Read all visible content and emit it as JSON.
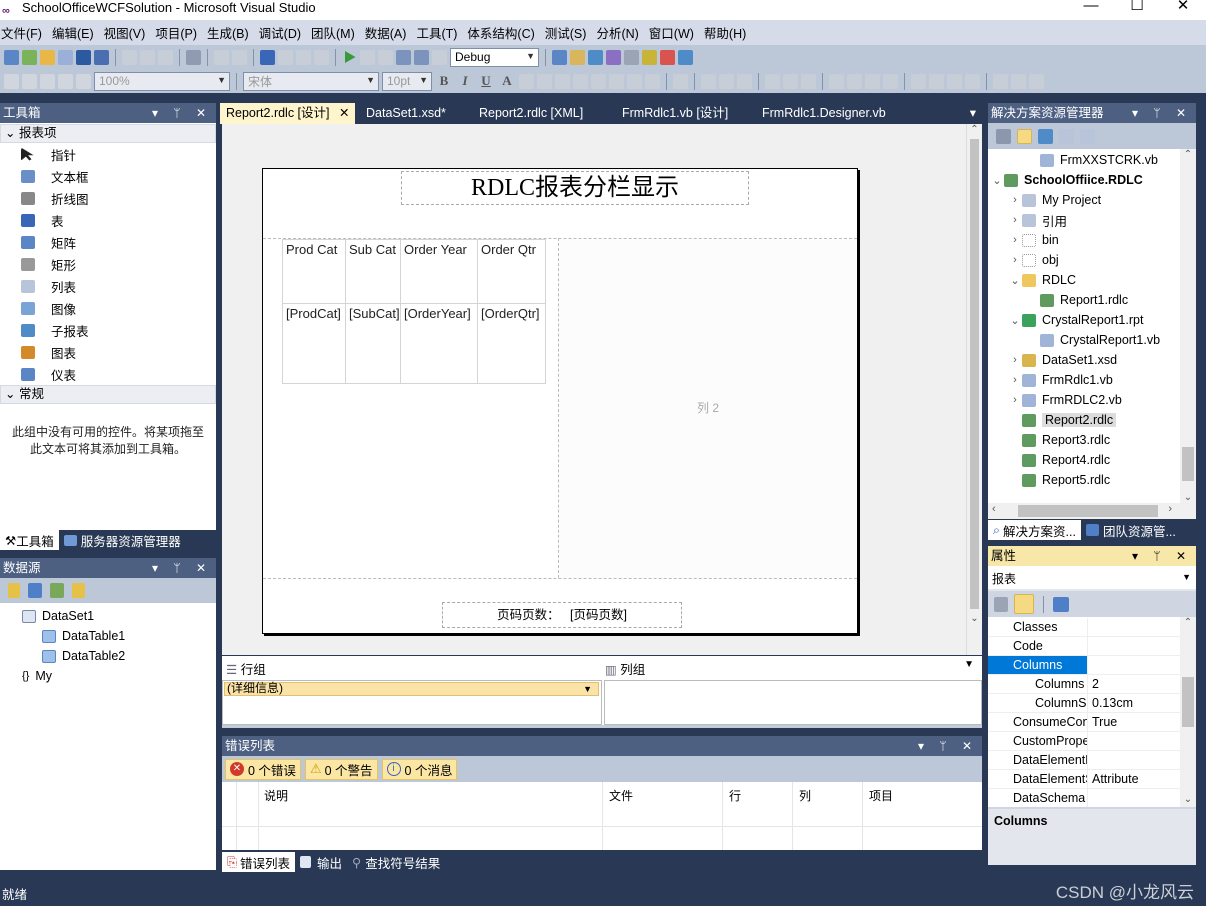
{
  "window": {
    "title": "SchoolOfficeWCFSolution - Microsoft Visual Studio",
    "minimize": "—",
    "maximize": "☐",
    "close": "✕"
  },
  "menu": [
    "文件(F)",
    "编辑(E)",
    "视图(V)",
    "项目(P)",
    "生成(B)",
    "调试(D)",
    "团队(M)",
    "数据(A)",
    "工具(T)",
    "体系结构(C)",
    "测试(S)",
    "分析(N)",
    "窗口(W)",
    "帮助(H)"
  ],
  "toolbar": {
    "config": "Debug",
    "zoom": "100%",
    "font": "宋体",
    "font_size": "10pt",
    "bold": "B",
    "italic": "I",
    "underline": "U",
    "fontcolor": "A"
  },
  "toolbox": {
    "title": "工具箱",
    "category1": "报表项",
    "items": [
      {
        "label": "指针",
        "icon": "pointer-icon"
      },
      {
        "label": "文本框",
        "icon": "textbox-icon"
      },
      {
        "label": "折线图",
        "icon": "line-icon"
      },
      {
        "label": "表",
        "icon": "table-icon"
      },
      {
        "label": "矩阵",
        "icon": "matrix-icon"
      },
      {
        "label": "矩形",
        "icon": "rectangle-icon"
      },
      {
        "label": "列表",
        "icon": "list-icon"
      },
      {
        "label": "图像",
        "icon": "image-icon"
      },
      {
        "label": "子报表",
        "icon": "subreport-icon"
      },
      {
        "label": "图表",
        "icon": "chart-icon"
      },
      {
        "label": "仪表",
        "icon": "gauge-icon"
      }
    ],
    "category2": "常规",
    "empty_text": "此组中没有可用的控件。将某项拖至此文本可将其添加到工具箱。",
    "tabs": [
      "工具箱",
      "服务器资源管理器"
    ]
  },
  "datasource": {
    "title": "数据源",
    "tree": [
      {
        "label": "DataSet1",
        "level": 1
      },
      {
        "label": "DataTable1",
        "level": 2
      },
      {
        "label": "DataTable2",
        "level": 2
      },
      {
        "label": "My",
        "level": 1
      }
    ]
  },
  "doc_tabs": [
    "Report2.rdlc [设计]",
    "DataSet1.xsd*",
    "Report2.rdlc [XML]",
    "FrmRdlc1.vb [设计]",
    "FrmRdlc1.Designer.vb"
  ],
  "report": {
    "title": "RDLC报表分栏显示",
    "headers": [
      "Prod Cat",
      "Sub Cat",
      "Order Year",
      "Order Qtr"
    ],
    "fields": [
      "[ProdCat]",
      "[SubCat]",
      "[OrderYear]",
      "[OrderQtr]"
    ],
    "column2": "列 2",
    "footer": "页码页数：   [页码页数]"
  },
  "grouping": {
    "row_group": "行组",
    "col_group": "列组",
    "detail": "(详细信息)"
  },
  "errorlist": {
    "title": "错误列表",
    "errors": "0 个错误",
    "warnings": "0 个警告",
    "messages": "0 个消息",
    "columns": [
      "说明",
      "文件",
      "行",
      "列",
      "项目"
    ],
    "tabs": [
      "错误列表",
      "输出",
      "查找符号结果"
    ]
  },
  "solution": {
    "title": "解决方案资源管理器",
    "tree": [
      {
        "label": "FrmXXSTCRK.vb",
        "level": 2,
        "chev": ""
      },
      {
        "label": "SchoolOffiice.RDLC",
        "level": 0,
        "chev": "⌄",
        "bold": true
      },
      {
        "label": "My Project",
        "level": 1,
        "chev": "›"
      },
      {
        "label": "引用",
        "level": 1,
        "chev": "›"
      },
      {
        "label": "bin",
        "level": 1,
        "chev": "›"
      },
      {
        "label": "obj",
        "level": 1,
        "chev": "›"
      },
      {
        "label": "RDLC",
        "level": 1,
        "chev": "⌄"
      },
      {
        "label": "Report1.rdlc",
        "level": 2,
        "chev": ""
      },
      {
        "label": "CrystalReport1.rpt",
        "level": 1,
        "chev": "⌄"
      },
      {
        "label": "CrystalReport1.vb",
        "level": 2,
        "chev": ""
      },
      {
        "label": "DataSet1.xsd",
        "level": 1,
        "chev": "›"
      },
      {
        "label": "FrmRdlc1.vb",
        "level": 1,
        "chev": "›"
      },
      {
        "label": "FrmRDLC2.vb",
        "level": 1,
        "chev": "›"
      },
      {
        "label": "Report2.rdlc",
        "level": 1,
        "chev": "",
        "selected": true
      },
      {
        "label": "Report3.rdlc",
        "level": 1,
        "chev": ""
      },
      {
        "label": "Report4.rdlc",
        "level": 1,
        "chev": ""
      },
      {
        "label": "Report5.rdlc",
        "level": 1,
        "chev": ""
      }
    ],
    "tabs": [
      "解决方案资...",
      "团队资源管..."
    ]
  },
  "properties": {
    "title": "属性",
    "object": "报表",
    "rows": [
      {
        "k": "Classes",
        "v": ""
      },
      {
        "k": "Code",
        "v": ""
      },
      {
        "k": "Columns",
        "v": "",
        "selected": true,
        "expanded": true
      },
      {
        "k": "Columns",
        "v": "2",
        "sub": true
      },
      {
        "k": "ColumnSpacing",
        "v": "0.13cm",
        "sub": true
      },
      {
        "k": "ConsumeContainerWhitespace",
        "v": "True"
      },
      {
        "k": "CustomProperties",
        "v": ""
      },
      {
        "k": "DataElementName",
        "v": ""
      },
      {
        "k": "DataElementStyle",
        "v": "Attribute"
      },
      {
        "k": "DataSchema",
        "v": ""
      }
    ],
    "description": "Columns"
  },
  "status": {
    "text": "就绪",
    "watermark": "CSDN @小龙风云"
  },
  "colors": {
    "chrome": "#293955",
    "panel_header": "#4d6082",
    "active_header": "#f7e7a8",
    "selection": "#0078d7"
  }
}
